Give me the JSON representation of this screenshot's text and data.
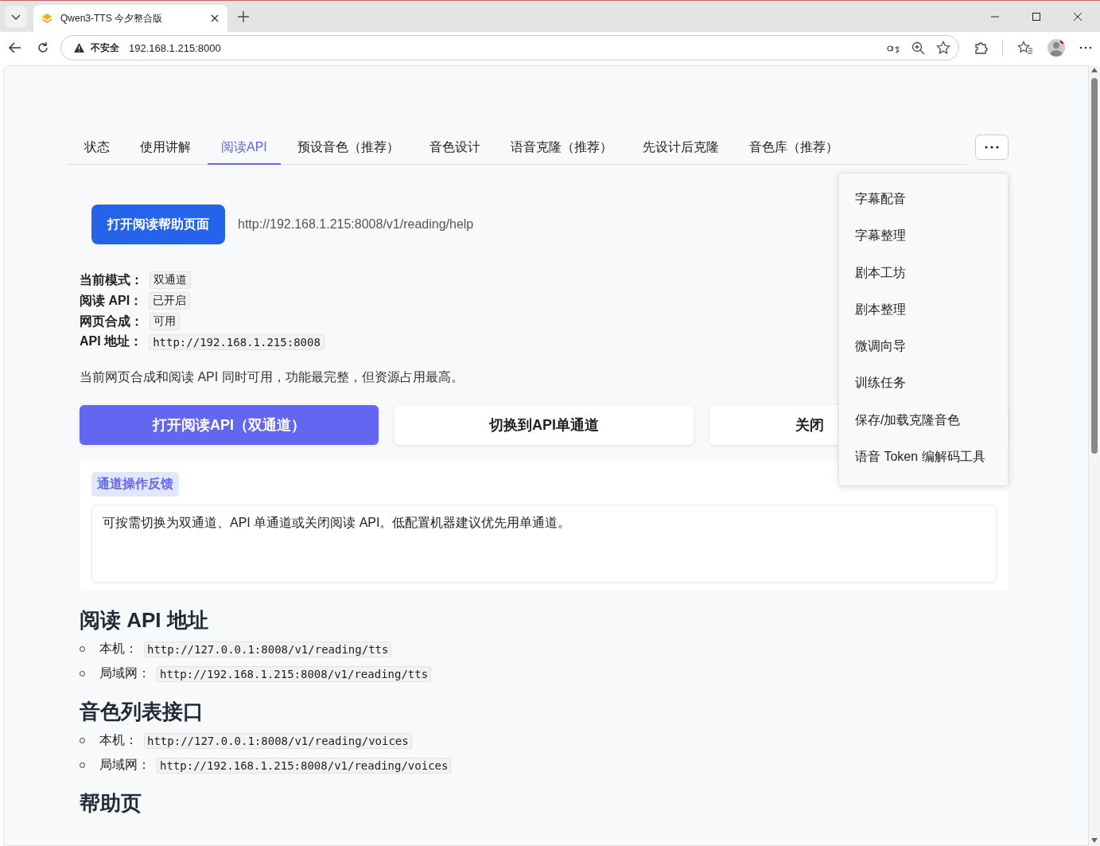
{
  "browser": {
    "tab_title": "Qwen3-TTS 今夕整合版",
    "security_label": "不安全",
    "url": "192.168.1.215:8000"
  },
  "nav_tabs": [
    {
      "label": "状态",
      "selected": false
    },
    {
      "label": "使用讲解",
      "selected": false
    },
    {
      "label": "阅读API",
      "selected": true
    },
    {
      "label": "预设音色（推荐）",
      "selected": false
    },
    {
      "label": "音色设计",
      "selected": false
    },
    {
      "label": "语音克隆（推荐）",
      "selected": false
    },
    {
      "label": "先设计后克隆",
      "selected": false
    },
    {
      "label": "音色库（推荐）",
      "selected": false
    }
  ],
  "more_menu": {
    "expanded": true,
    "items": [
      "字幕配音",
      "字幕整理",
      "剧本工坊",
      "剧本整理",
      "微调向导",
      "训练任务",
      "保存/加载克隆音色",
      "语音 Token 编解码工具"
    ]
  },
  "help": {
    "button": "打开阅读帮助页面",
    "url": "http://192.168.1.215:8008/v1/reading/help"
  },
  "status_fields": [
    {
      "label": "当前模式：",
      "value": "双通道",
      "kind": "text"
    },
    {
      "label": "阅读 API：",
      "value": "已开启",
      "kind": "text"
    },
    {
      "label": "网页合成：",
      "value": "可用",
      "kind": "text"
    },
    {
      "label": "API 地址：",
      "value": "http://192.168.1.215:8008",
      "kind": "code"
    }
  ],
  "description": "当前网页合成和阅读 API 同时可用，功能最完整，但资源占用最高。",
  "mode_buttons": [
    {
      "label": "打开阅读API（双通道）",
      "selected": true
    },
    {
      "label": "切换到API单通道",
      "selected": false
    },
    {
      "label": "关闭",
      "selected": false
    }
  ],
  "feedback": {
    "label": "通道操作反馈",
    "text": "可按需切换为双通道、API 单通道或关闭阅读 API。低配置机器建议优先用单通道。"
  },
  "sections": [
    {
      "heading": "阅读 API 地址",
      "items": [
        {
          "label": "本机：",
          "url": "http://127.0.0.1:8008/v1/reading/tts"
        },
        {
          "label": "局域网：",
          "url": "http://192.168.1.215:8008/v1/reading/tts"
        }
      ]
    },
    {
      "heading": "音色列表接口",
      "items": [
        {
          "label": "本机：",
          "url": "http://127.0.0.1:8008/v1/reading/voices"
        },
        {
          "label": "局域网：",
          "url": "http://192.168.1.215:8008/v1/reading/voices"
        }
      ]
    },
    {
      "heading": "帮助页"
    }
  ]
}
